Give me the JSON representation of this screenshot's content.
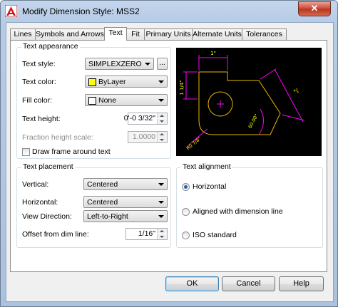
{
  "window": {
    "title": "Modify Dimension Style: MSS2",
    "close_glyph": "✕"
  },
  "tabs": [
    {
      "label": "Lines"
    },
    {
      "label": "Symbols and Arrows"
    },
    {
      "label": "Text"
    },
    {
      "label": "Fit"
    },
    {
      "label": "Primary Units"
    },
    {
      "label": "Alternate Units"
    },
    {
      "label": "Tolerances"
    }
  ],
  "active_tab": "Text",
  "text_appearance": {
    "title": "Text appearance",
    "text_style_label": "Text style:",
    "text_style_value": "SIMPLEXZERO",
    "browse_label": "...",
    "text_color_label": "Text color:",
    "text_color_value": "ByLayer",
    "text_color_swatch": "#ffff00",
    "fill_color_label": "Fill color:",
    "fill_color_value": "None",
    "fill_color_swatch": "#ffffff",
    "text_height_label": "Text height:",
    "text_height_value": "0'-0 3/32\"",
    "fraction_label": "Fraction height scale:",
    "fraction_value": "1.0000",
    "draw_frame_label": "Draw frame around text",
    "draw_frame_checked": false
  },
  "text_placement": {
    "title": "Text placement",
    "vertical_label": "Vertical:",
    "vertical_value": "Centered",
    "horizontal_label": "Horizontal:",
    "horizontal_value": "Centered",
    "view_direction_label": "View Direction:",
    "view_direction_value": "Left-to-Right",
    "offset_label": "Offset from dim line:",
    "offset_value": "1/16\""
  },
  "text_alignment": {
    "title": "Text alignment",
    "options": [
      {
        "label": "Horizontal",
        "selected": true
      },
      {
        "label": "Aligned with dimension line",
        "selected": false
      },
      {
        "label": "ISO standard",
        "selected": false
      }
    ]
  },
  "preview": {
    "dim_top": "1\"",
    "dim_left": "1 1/4\"",
    "dim_right": "2\"",
    "dim_angle": "60.00°",
    "dim_radius": "R0 7/8\"",
    "colors": {
      "background": "#000000",
      "geometry": "#e6b800",
      "dimension": "#ff00ff",
      "text": "#ffff00"
    }
  },
  "buttons": {
    "ok": "OK",
    "cancel": "Cancel",
    "help": "Help"
  }
}
